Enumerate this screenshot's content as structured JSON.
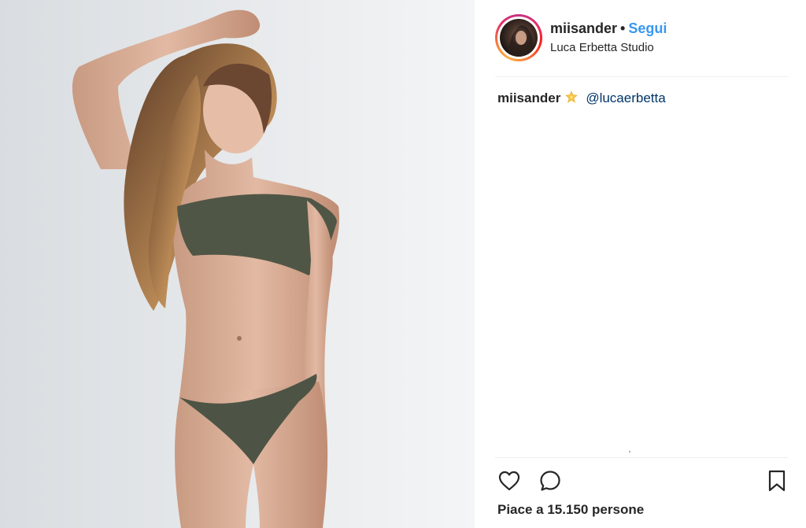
{
  "post": {
    "photo_alt": "",
    "accent_color": "#3897f0",
    "header": {
      "username": "miisander",
      "separator": "•",
      "follow_label": "Segui",
      "location": "Luca Erbetta Studio"
    },
    "caption": {
      "username": "miisander",
      "emoji": "star-icon",
      "mention": "@lucaerbetta"
    },
    "actions": {
      "icons": [
        "heart-icon",
        "comment-icon",
        "bookmark-icon"
      ]
    },
    "likes_text": "Piace a 15.150 persone"
  }
}
